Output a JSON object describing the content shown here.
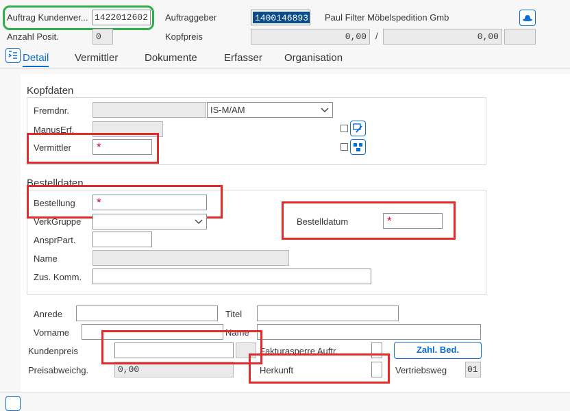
{
  "header": {
    "auftrag_label": "Auftrag Kundenver...",
    "auftrag_value": "1422012602",
    "anzahl_label": "Anzahl Posit.",
    "anzahl_value": "0",
    "auftraggeber_label": "Auftraggeber",
    "auftraggeber_value": "1400146893",
    "auftraggeber_name": "Paul Filter Möbelspedition Gmb",
    "kopfpreis_label": "Kopfpreis",
    "kopfpreis_value1": "0,00",
    "kopfpreis_sep": "/",
    "kopfpreis_value2": "0,00"
  },
  "tabs": [
    {
      "label": "Detail",
      "active": true
    },
    {
      "label": "Vermittler"
    },
    {
      "label": "Dokumente"
    },
    {
      "label": "Erfasser"
    },
    {
      "label": "Organisation"
    }
  ],
  "kopfdaten": {
    "title": "Kopfdaten",
    "fremdnr_label": "Fremdnr.",
    "fremdnr_select": "IS-M/AM",
    "manuserf_label": "ManusErf.",
    "vermittler_label": "Vermittler",
    "required_mark": "*"
  },
  "bestelldaten": {
    "title": "Bestelldaten",
    "bestellung_label": "Bestellung",
    "verkgruppe_label": "VerkGruppe",
    "ansprpart_label": "AnsprPart.",
    "name_label": "Name",
    "zuskomm_label": "Zus. Komm.",
    "bestelldatum_label": "Bestelldatum",
    "required_mark": "*"
  },
  "lower": {
    "anrede_label": "Anrede",
    "titel_label": "Titel",
    "vorname_label": "Vorname",
    "name_label": "Name",
    "kundenpreis_label": "Kundenpreis",
    "fakturasperre_label": "Fakturasperre Auftr.",
    "zahl_bed_button": "Zahl. Bed.",
    "preisabweichg_label": "Preisabweichg.",
    "preisabweichg_value": "0,00",
    "herkunft_label": "Herkunft",
    "vertriebsweg_label": "Vertriebsweg",
    "vertriebsweg_value": "01"
  },
  "colors": {
    "accent": "#0a6ed1",
    "required": "#d9002b",
    "annotation_red": "#e32b2b",
    "annotation_green": "#2fae4a"
  }
}
